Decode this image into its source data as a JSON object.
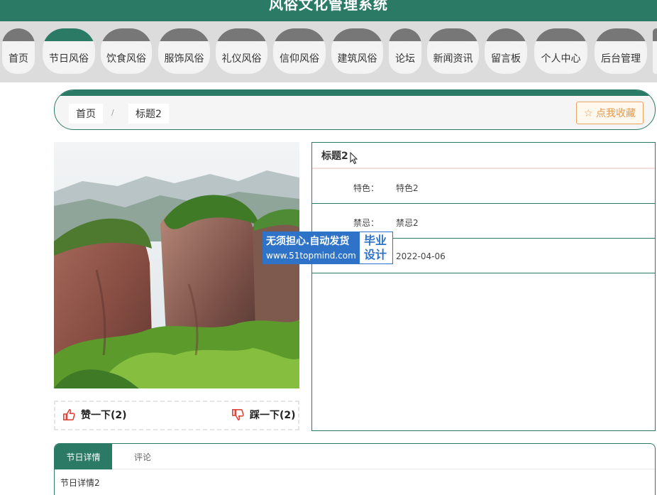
{
  "app": {
    "title": "风俗文化管理系统"
  },
  "nav": {
    "items": [
      {
        "label": "首页"
      },
      {
        "label": "节日风俗"
      },
      {
        "label": "饮食风俗"
      },
      {
        "label": "服饰风俗"
      },
      {
        "label": "礼仪风俗"
      },
      {
        "label": "信仰风俗"
      },
      {
        "label": "建筑风俗"
      },
      {
        "label": "论坛"
      },
      {
        "label": "新闻资讯"
      },
      {
        "label": "留言板"
      },
      {
        "label": "个人中心"
      },
      {
        "label": "后台管理"
      }
    ],
    "active_index": 1
  },
  "breadcrumb": {
    "home": "首页",
    "separator": "/",
    "current": "标题2"
  },
  "favorite_button": {
    "label": "☆ 点我收藏"
  },
  "detail": {
    "title": "标题2",
    "rows": [
      {
        "label": "特色：",
        "value": "特色2"
      },
      {
        "label": "禁忌：",
        "value": "禁忌2"
      },
      {
        "label": "",
        "value": "2022-04-06"
      }
    ]
  },
  "votes": {
    "like_label": "赞一下(2)",
    "dislike_label": "踩一下(2)"
  },
  "watermark": {
    "line1": "无须担心.自动发货",
    "line2": "www.51topmind.com",
    "right": "毕业设计"
  },
  "tabs": {
    "items": [
      {
        "label": "节日详情"
      },
      {
        "label": "评论"
      }
    ],
    "active_index": 0,
    "content": "节日详情2"
  },
  "colors": {
    "primary": "#2b7a66",
    "favorite": "#e39a4f",
    "watermark": "#2e73c8",
    "vote_icon": "#e0453a"
  }
}
